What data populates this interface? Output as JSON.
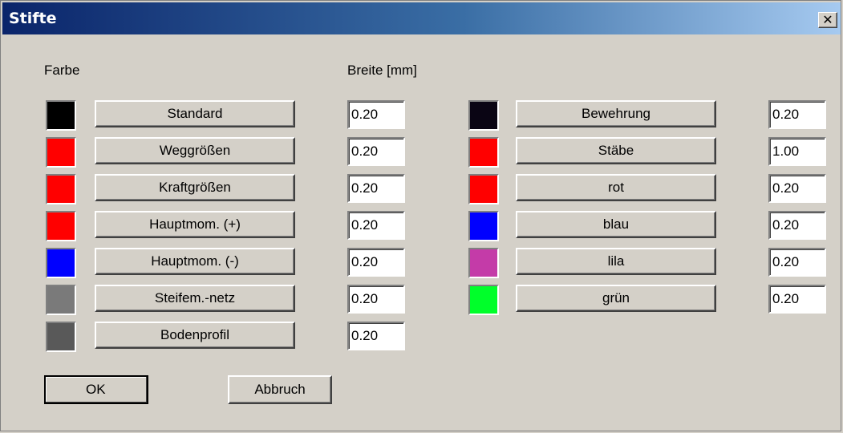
{
  "window": {
    "title": "Stifte",
    "close_glyph": "✕"
  },
  "headers": {
    "color": "Farbe",
    "width": "Breite [mm]"
  },
  "left_pens": [
    {
      "label": "Standard",
      "color": "#000000",
      "width": "0.20"
    },
    {
      "label": "Weggrößen",
      "color": "#ff0000",
      "width": "0.20"
    },
    {
      "label": "Kraftgrößen",
      "color": "#ff0000",
      "width": "0.20"
    },
    {
      "label": "Hauptmom. (+)",
      "color": "#ff0000",
      "width": "0.20"
    },
    {
      "label": "Hauptmom. (-)",
      "color": "#0000ff",
      "width": "0.20"
    },
    {
      "label": "Steifem.-netz",
      "color": "#7a7a7a",
      "width": "0.20"
    },
    {
      "label": "Bodenprofil",
      "color": "#595959",
      "width": "0.20"
    }
  ],
  "right_pens": [
    {
      "label": "Bewehrung",
      "color": "#0a0514",
      "width": "0.20"
    },
    {
      "label": "Stäbe",
      "color": "#ff0000",
      "width": "1.00"
    },
    {
      "label": "rot",
      "color": "#ff0000",
      "width": "0.20"
    },
    {
      "label": "blau",
      "color": "#0000ff",
      "width": "0.20"
    },
    {
      "label": "lila",
      "color": "#c43ba8",
      "width": "0.20"
    },
    {
      "label": "grün",
      "color": "#00ff2a",
      "width": "0.20"
    }
  ],
  "buttons": {
    "ok": "OK",
    "cancel": "Abbruch"
  }
}
